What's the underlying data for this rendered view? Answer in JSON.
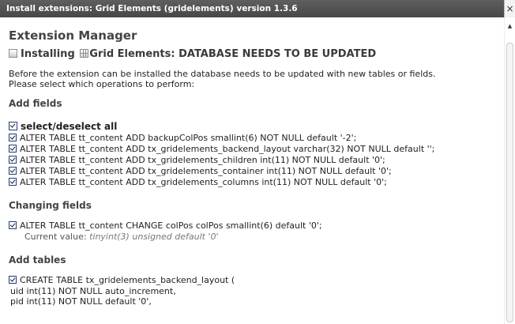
{
  "window": {
    "title": "Install extensions: Grid Elements (gridelements) version 1.3.6",
    "close_glyph": "×"
  },
  "header": {
    "title": "Extension Manager",
    "installing_label": "Installing",
    "extension_name": "Grid Elements: DATABASE NEEDS TO BE UPDATED"
  },
  "intro": {
    "line1": "Before the extension can be installed the database needs to be updated with new tables or fields.",
    "line2": "Please select which operations to perform:"
  },
  "add_fields": {
    "heading": "Add fields",
    "select_all_label": "select/deselect all",
    "items": [
      "ALTER TABLE tt_content ADD backupColPos smallint(6) NOT NULL default '-2';",
      "ALTER TABLE tt_content ADD tx_gridelements_backend_layout varchar(32) NOT NULL default '';",
      "ALTER TABLE tt_content ADD tx_gridelements_children int(11) NOT NULL default '0';",
      "ALTER TABLE tt_content ADD tx_gridelements_container int(11) NOT NULL default '0';",
      "ALTER TABLE tt_content ADD tx_gridelements_columns int(11) NOT NULL default '0';"
    ]
  },
  "changing_fields": {
    "heading": "Changing fields",
    "item": "ALTER TABLE tt_content CHANGE colPos colPos smallint(6) default '0';",
    "current_label": "Current value:",
    "current_value": "tinyint(3) unsigned default '0'"
  },
  "add_tables": {
    "heading": "Add tables",
    "item_line1": "CREATE TABLE tx_gridelements_backend_layout (",
    "item_line2": "uid int(11) NOT NULL auto_increment,",
    "item_line3": "pid int(11) NOT NULL default '0',"
  },
  "icons": {
    "installing": "extension-icon",
    "grid_elements": "grid-icon",
    "close": "close-icon",
    "scroll_up": "scroll-up-arrow-icon"
  },
  "colors": {
    "titlebar": "#4d4d4d",
    "heading": "#444444",
    "checkbox_border": "#1e3f80"
  }
}
